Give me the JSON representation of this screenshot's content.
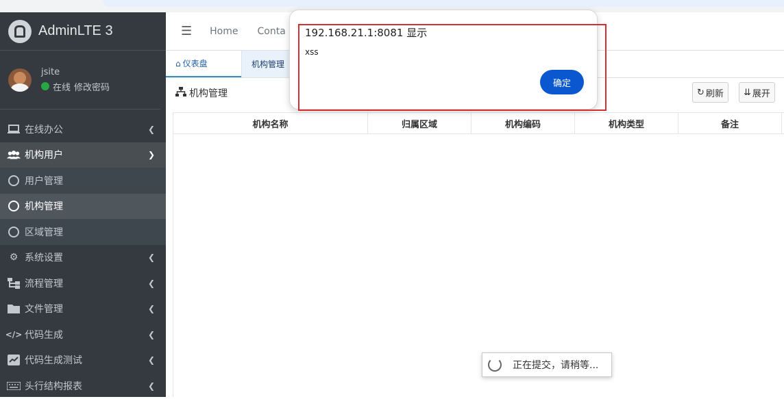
{
  "brand": {
    "name": "AdminLTE 3"
  },
  "user": {
    "name": "jsite",
    "status": "在线",
    "change_password": "修改密码"
  },
  "sidebar": {
    "items": [
      {
        "label": "在线办公",
        "icon": "laptop-icon"
      },
      {
        "label": "机构用户",
        "icon": "users-icon"
      },
      {
        "label": "用户管理",
        "icon": "circle-icon"
      },
      {
        "label": "机构管理",
        "icon": "circle-icon"
      },
      {
        "label": "区域管理",
        "icon": "circle-icon"
      },
      {
        "label": "系统设置",
        "icon": "gear-icon"
      },
      {
        "label": "流程管理",
        "icon": "sitemap-icon"
      },
      {
        "label": "文件管理",
        "icon": "folder-icon"
      },
      {
        "label": "代码生成",
        "icon": "code-icon"
      },
      {
        "label": "代码生成测试",
        "icon": "chart-icon"
      },
      {
        "label": "头行结构报表",
        "icon": "keyboard-icon"
      }
    ]
  },
  "topnav": {
    "home": "Home",
    "contact": "Conta"
  },
  "tabs": {
    "dashboard": "仪表盘",
    "org": "机构管理"
  },
  "page": {
    "title": "机构管理",
    "refresh": "刷新",
    "expand": "展开"
  },
  "table": {
    "columns": [
      "机构名称",
      "归属区域",
      "机构编码",
      "机构类型",
      "备注"
    ]
  },
  "alert": {
    "title": "192.168.21.1:8081 显示",
    "message": "xss",
    "ok": "确定"
  },
  "loading": {
    "text": "正在提交，请稍等..."
  },
  "colors": {
    "sidebar": "#343a40",
    "accent": "#0b57d0",
    "highlight": "#d32f2f"
  }
}
